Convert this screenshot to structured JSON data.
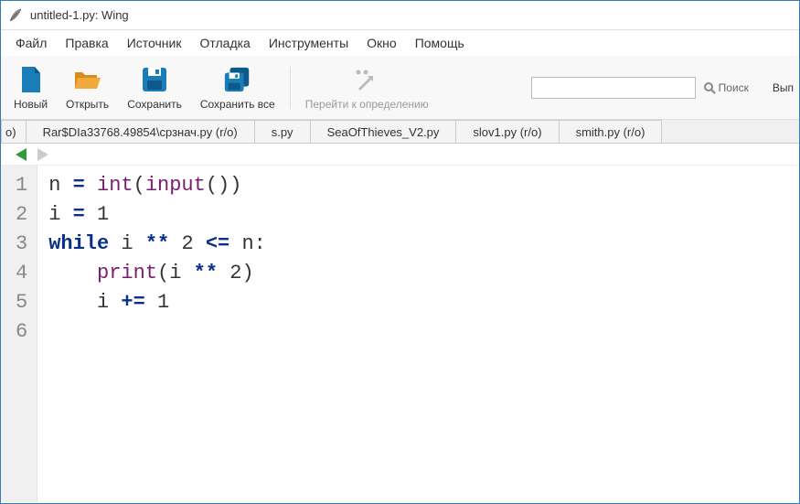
{
  "window": {
    "title": "untitled-1.py: Wing"
  },
  "menu": {
    "items": [
      "Файл",
      "Правка",
      "Источник",
      "Отладка",
      "Инструменты",
      "Окно",
      "Помощь"
    ]
  },
  "toolbar": {
    "new": "Новый",
    "open": "Открыть",
    "save": "Сохранить",
    "save_all": "Сохранить все",
    "goto_def": "Перейти к определению",
    "search_label": "Поиск",
    "search_placeholder": "",
    "right_cut": "Вып"
  },
  "tabs": [
    {
      "label": "o)"
    },
    {
      "label": "Rar$DIa33768.49854\\срзнач.py (r/o)"
    },
    {
      "label": "s.py"
    },
    {
      "label": "SeaOfThieves_V2.py"
    },
    {
      "label": "slov1.py (r/o)"
    },
    {
      "label": "smith.py (r/o)"
    }
  ],
  "code": {
    "line_numbers": [
      "1",
      "2",
      "3",
      "4",
      "5",
      "6"
    ],
    "tokens": [
      [
        {
          "t": "name",
          "v": "n"
        },
        {
          "t": "sp",
          "v": " "
        },
        {
          "t": "op",
          "v": "="
        },
        {
          "t": "sp",
          "v": " "
        },
        {
          "t": "builtin",
          "v": "int"
        },
        {
          "t": "punc",
          "v": "("
        },
        {
          "t": "builtin",
          "v": "input"
        },
        {
          "t": "punc",
          "v": "("
        },
        {
          "t": "punc",
          "v": ")"
        },
        {
          "t": "punc",
          "v": ")"
        }
      ],
      [
        {
          "t": "name",
          "v": "i"
        },
        {
          "t": "sp",
          "v": " "
        },
        {
          "t": "op",
          "v": "="
        },
        {
          "t": "sp",
          "v": " "
        },
        {
          "t": "num",
          "v": "1"
        }
      ],
      [
        {
          "t": "kw",
          "v": "while"
        },
        {
          "t": "sp",
          "v": " "
        },
        {
          "t": "name",
          "v": "i"
        },
        {
          "t": "sp",
          "v": " "
        },
        {
          "t": "op",
          "v": "**"
        },
        {
          "t": "sp",
          "v": " "
        },
        {
          "t": "num",
          "v": "2"
        },
        {
          "t": "sp",
          "v": " "
        },
        {
          "t": "op",
          "v": "<="
        },
        {
          "t": "sp",
          "v": " "
        },
        {
          "t": "name",
          "v": "n"
        },
        {
          "t": "punc",
          "v": ":"
        }
      ],
      [
        {
          "t": "sp",
          "v": "    "
        },
        {
          "t": "builtin",
          "v": "print"
        },
        {
          "t": "punc",
          "v": "("
        },
        {
          "t": "name",
          "v": "i"
        },
        {
          "t": "sp",
          "v": " "
        },
        {
          "t": "op",
          "v": "**"
        },
        {
          "t": "sp",
          "v": " "
        },
        {
          "t": "num",
          "v": "2"
        },
        {
          "t": "punc",
          "v": ")"
        }
      ],
      [
        {
          "t": "sp",
          "v": "    "
        },
        {
          "t": "name",
          "v": "i"
        },
        {
          "t": "sp",
          "v": " "
        },
        {
          "t": "op",
          "v": "+="
        },
        {
          "t": "sp",
          "v": " "
        },
        {
          "t": "num",
          "v": "1"
        }
      ],
      []
    ]
  }
}
